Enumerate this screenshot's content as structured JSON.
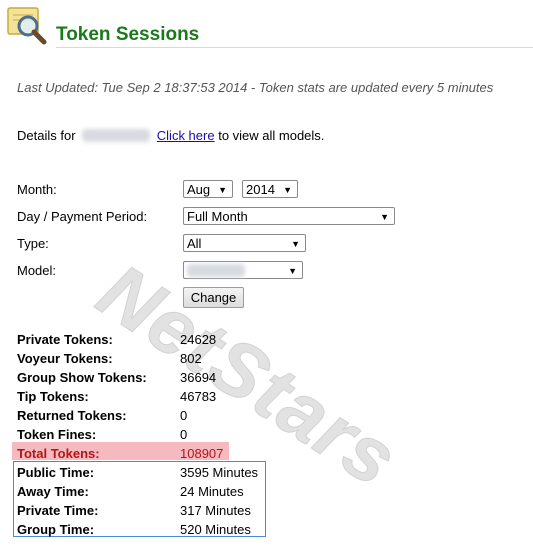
{
  "header": {
    "title": "Token Sessions",
    "icon": "magnifier-folder-icon"
  },
  "last_updated": "Last Updated: Tue Sep 2 18:37:53 2014 - Token stats are updated every 5 minutes",
  "details": {
    "prefix": "Details for",
    "link_text": "Click here",
    "suffix": "to view all models."
  },
  "form": {
    "month_label": "Month:",
    "month_value": "Aug",
    "year_value": "2014",
    "period_label": "Day / Payment Period:",
    "period_value": "Full Month",
    "type_label": "Type:",
    "type_value": "All",
    "model_label": "Model:",
    "change_button": "Change"
  },
  "stats": [
    {
      "label": "Private Tokens:",
      "value": "24628"
    },
    {
      "label": "Voyeur Tokens:",
      "value": "802"
    },
    {
      "label": "Group Show Tokens:",
      "value": "36694"
    },
    {
      "label": "Tip Tokens:",
      "value": "46783"
    },
    {
      "label": "Returned Tokens:",
      "value": "0"
    },
    {
      "label": "Token Fines:",
      "value": "0"
    },
    {
      "label": "Total Tokens:",
      "value": "108907"
    },
    {
      "label": "Public Time:",
      "value": "3595 Minutes"
    },
    {
      "label": "Away Time:",
      "value": "24 Minutes"
    },
    {
      "label": "Private Time:",
      "value": "317 Minutes"
    },
    {
      "label": "Group Time:",
      "value": "520 Minutes"
    }
  ],
  "watermark": "NetStars",
  "colors": {
    "title": "#1a7a1a",
    "total_highlight": "#f6b9bf",
    "total_text": "#b01818",
    "time_box_border": "#4a8bd0"
  }
}
